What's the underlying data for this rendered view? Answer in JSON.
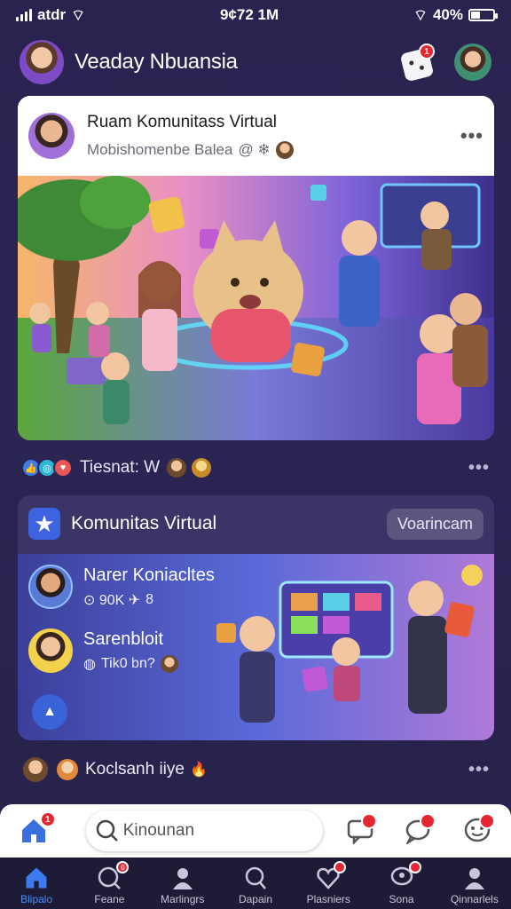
{
  "status": {
    "left": "atdr",
    "time": "9¢72 1M",
    "battery": "40%"
  },
  "header": {
    "title": "Veaday Nbuansia",
    "notif_count": "1"
  },
  "post": {
    "title": "Ruam Komunitass Virtual",
    "subtitle": "Mobishomenbe Balea",
    "sub_suffix": "@ ❄"
  },
  "reactions_row": {
    "text": "Tiesnat: W"
  },
  "community": {
    "title": "Komunitas Virtual",
    "pill": "Voarincam",
    "members": [
      {
        "name": "Narer Koniacltes",
        "sub": "⊙ 90K ✈",
        "sub2": "8"
      },
      {
        "name": "Sarenbloit",
        "sub": "Tik0 bn?"
      }
    ]
  },
  "bottom_row": {
    "text": "Koclsanh iiye"
  },
  "composer": {
    "placeholder": "Kinounan"
  },
  "tabs": [
    {
      "label": "Blipalo"
    },
    {
      "label": "Feane"
    },
    {
      "label": "Marlingrs"
    },
    {
      "label": "Dapain"
    },
    {
      "label": "Plasniers"
    },
    {
      "label": "Sona"
    },
    {
      "label": "Qinnarlels"
    }
  ],
  "colors": {
    "accent": "#4a8cf7",
    "badge": "#e5252f",
    "bg": "#2a2350"
  }
}
